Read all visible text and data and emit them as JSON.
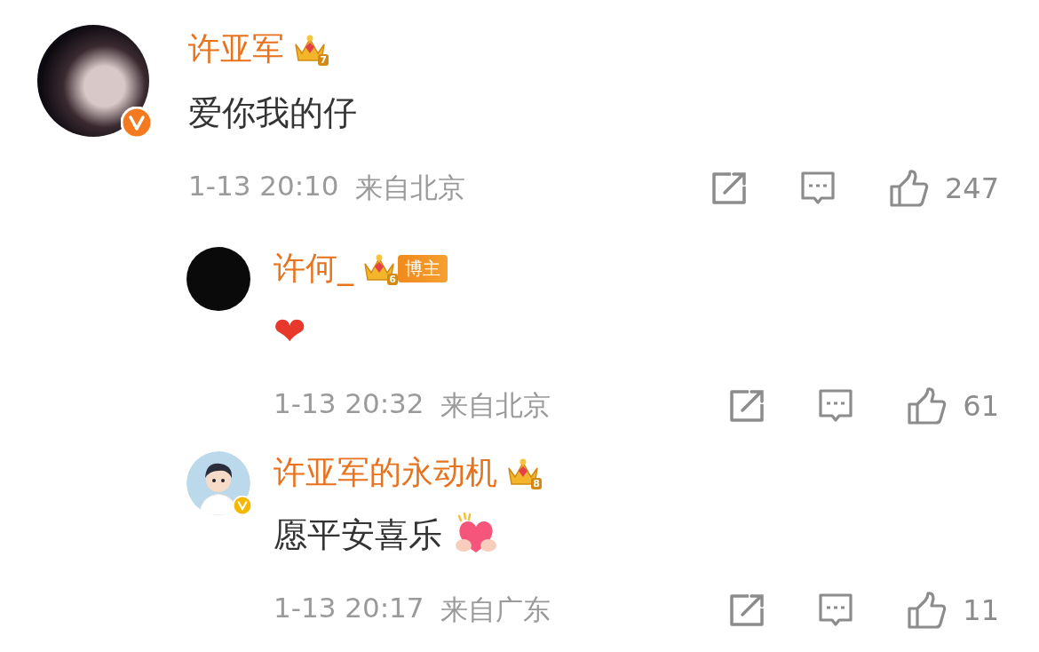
{
  "comments": [
    {
      "user": {
        "name": "许亚军",
        "crown_level": "7",
        "verified": {
          "color": "#f47a1f"
        },
        "avatar": {
          "kind": "photo"
        }
      },
      "content": {
        "text": "爱你我的仔"
      },
      "time": "1-13 20:10",
      "location": "来自北京",
      "likes": "247",
      "replies": [
        {
          "user": {
            "name": "许何_",
            "crown_level": "6",
            "badge": "博主",
            "avatar": {
              "kind": "plain"
            }
          },
          "content": {
            "text": "❤"
          },
          "time": "1-13 20:32",
          "location": "来自北京",
          "likes": "61"
        },
        {
          "user": {
            "name": "许亚军的永动机",
            "crown_level": "8",
            "verified": {
              "color": "#f5b800"
            },
            "avatar": {
              "kind": "cartoon"
            }
          },
          "content": {
            "text": "愿平安喜乐",
            "sticker": {
              "kind": "hands_heart"
            }
          },
          "time": "1-13 20:17",
          "location": "来自广东",
          "likes": "11"
        }
      ]
    }
  ]
}
